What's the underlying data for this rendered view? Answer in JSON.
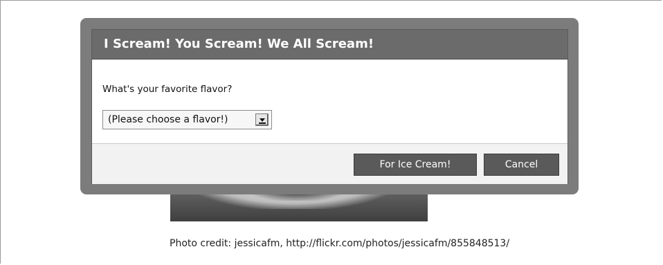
{
  "dialog": {
    "title": "I Scream! You Scream! We All Scream!",
    "question": "What's your favorite flavor?",
    "flavor_select": {
      "selected": "(Please choose a flavor!)"
    },
    "buttons": {
      "submit_label": "For Ice Cream!",
      "cancel_label": "Cancel"
    }
  },
  "photo": {
    "credit": "Photo credit: jessicafm, http://flickr.com/photos/jessicafm/855848513/"
  },
  "colors": {
    "title_bar": "#6b6b6b",
    "dialog_frame": "#7c7c7c",
    "button": "#5a5a5a",
    "footer": "#f2f2f2"
  }
}
